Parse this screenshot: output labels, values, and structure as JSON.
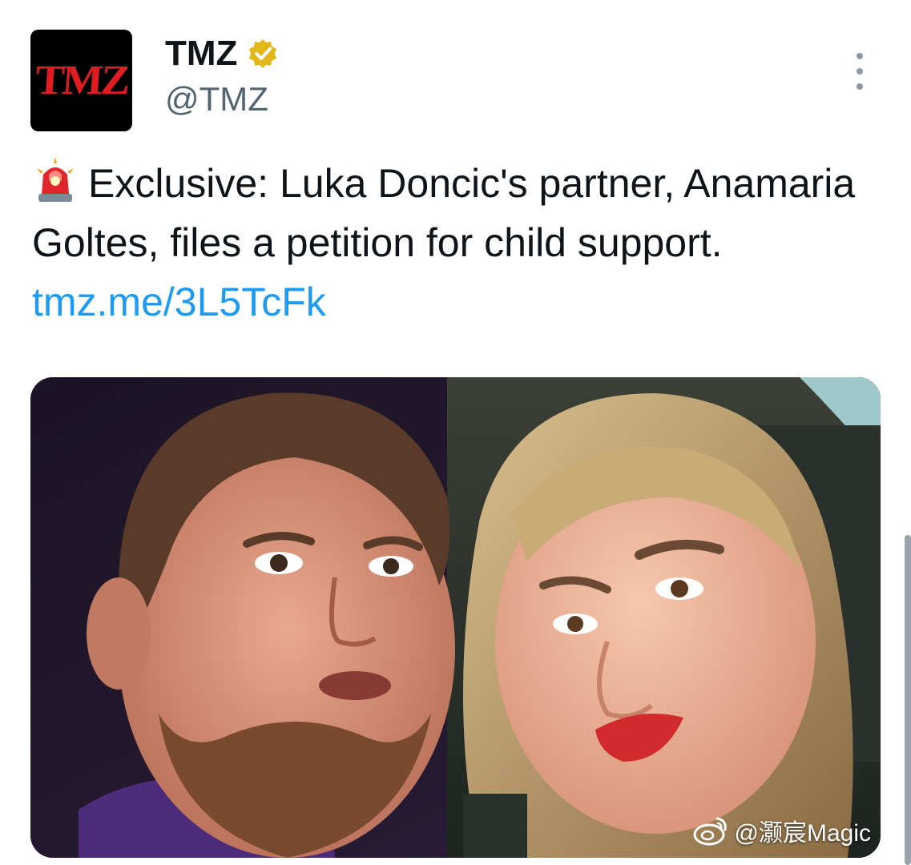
{
  "author": {
    "avatar_text": "TMZ",
    "display_name": "TMZ",
    "handle": "@TMZ",
    "verified_icon": "gold-verified-badge"
  },
  "tweet": {
    "emoji": "siren-emoji",
    "text": "Exclusive: Luka Doncic's partner, Anamaria Goltes, files a petition for child support.",
    "link": "tmz.me/3L5TcFk"
  },
  "media": {
    "description_icon": "photo",
    "accent": "#1d9bf0"
  },
  "watermark": {
    "text": "@灏宸Magic"
  },
  "colors": {
    "link": "#1d9bf0",
    "handle": "#536471",
    "brand_red": "#e01b22",
    "verified_gold": "#e2b719"
  }
}
